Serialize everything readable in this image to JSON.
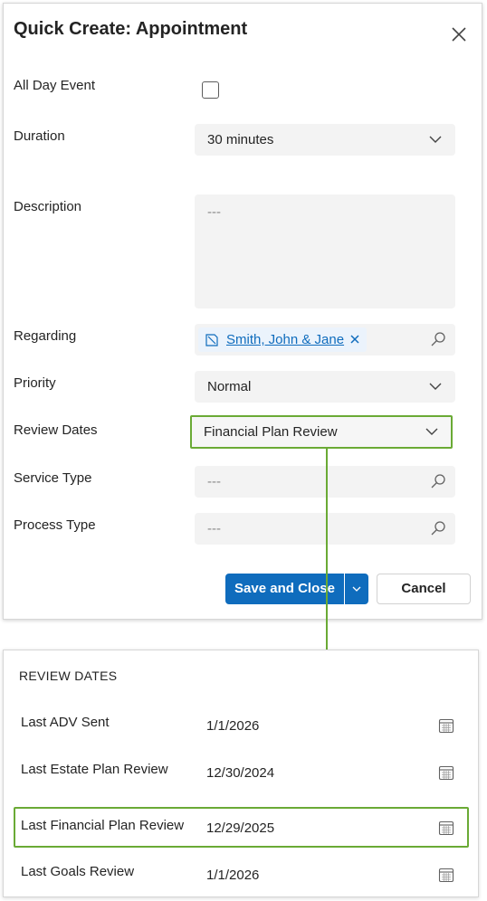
{
  "dialog": {
    "title": "Quick Create: Appointment",
    "fields": {
      "all_day": {
        "label": "All Day Event",
        "checked": false
      },
      "duration": {
        "label": "Duration",
        "value": "30 minutes"
      },
      "description": {
        "label": "Description",
        "placeholder": "---"
      },
      "regarding": {
        "label": "Regarding",
        "value": "Smith, John & Jane"
      },
      "priority": {
        "label": "Priority",
        "value": "Normal"
      },
      "review_dates": {
        "label": "Review Dates",
        "value": "Financial Plan Review"
      },
      "service_type": {
        "label": "Service Type",
        "placeholder": "---"
      },
      "process_type": {
        "label": "Process Type",
        "placeholder": "---"
      }
    },
    "buttons": {
      "save_close": "Save and Close",
      "cancel": "Cancel"
    }
  },
  "review_panel": {
    "title": "REVIEW DATES",
    "rows": [
      {
        "label": "Last ADV Sent",
        "date": "1/1/2026"
      },
      {
        "label": "Last Estate Plan Review",
        "date": "12/30/2024"
      },
      {
        "label": "Last Financial Plan Review",
        "date": "12/29/2025"
      },
      {
        "label": "Last Goals Review",
        "date": "1/1/2026"
      }
    ]
  },
  "colors": {
    "accent": "#0f6cbd",
    "highlight": "#6aaa35",
    "field_bg": "#f3f3f3"
  }
}
